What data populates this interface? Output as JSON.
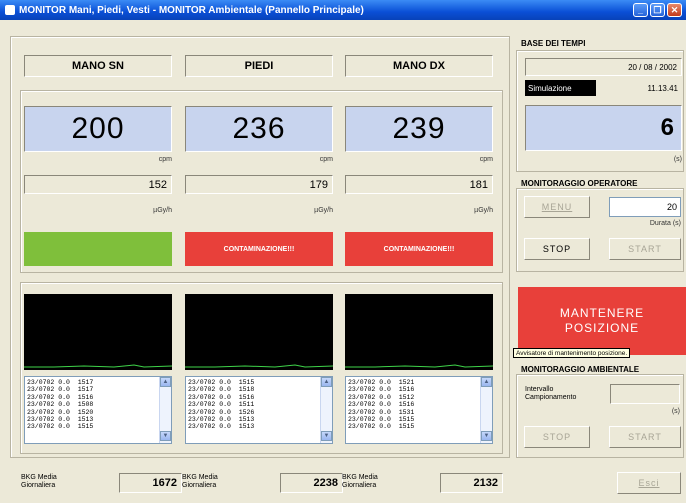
{
  "window": {
    "title": "MONITOR Mani, Piedi, Vesti - MONITOR Ambientale (Pannello Principale)"
  },
  "channels": [
    {
      "name": "MANO SN",
      "count": "200",
      "count_unit": "cpm",
      "dose": "152",
      "dose_unit": "µGy/h",
      "status": "",
      "status_color": "#7fbf3b",
      "log": [
        "23/0702 0.0  1517",
        "23/0702 0.0  1517",
        "23/0702 0.0  1516",
        "23/0702 0.0  1508",
        "23/0702 0.0  1520",
        "23/0702 0.0  1513",
        "23/0702 0.0  1515"
      ],
      "bkg_label": "BKG Media\nGiornaliera",
      "bkg_value": "1672"
    },
    {
      "name": "PIEDI",
      "count": "236",
      "count_unit": "cpm",
      "dose": "179",
      "dose_unit": "µGy/h",
      "status": "CONTAMINAZIONE!!!",
      "status_color": "#e8403a",
      "log": [
        "23/0702 0.0  1515",
        "23/0702 0.0  1518",
        "23/0702 0.0  1516",
        "23/0702 0.0  1511",
        "23/0702 0.0  1526",
        "23/0702 0.0  1513",
        "23/0702 0.0  1513"
      ],
      "bkg_label": "BKG Media\nGiornaliera",
      "bkg_value": "2238"
    },
    {
      "name": "MANO DX",
      "count": "239",
      "count_unit": "cpm",
      "dose": "181",
      "dose_unit": "µGy/h",
      "status": "CONTAMINAZIONE!!!",
      "status_color": "#e8403a",
      "log": [
        "23/0702 0.0  1521",
        "23/0702 0.0  1516",
        "23/0702 0.0  1512",
        "23/0702 0.0  1516",
        "23/0702 0.0  1531",
        "23/0702 0.0  1515",
        "23/0702 0.0  1515"
      ],
      "bkg_label": "BKG Media\nGiornaliera",
      "bkg_value": "2132"
    }
  ],
  "time_base": {
    "title": "BASE DEI TEMPI",
    "date": "20 / 08 / 2002",
    "mode": "Simulazione",
    "clock": "11.13.41",
    "seconds": "6",
    "seconds_unit": "(s)"
  },
  "operator": {
    "title": "MONITORAGGIO OPERATORE",
    "menu_label": "MENU",
    "duration_value": "20",
    "duration_label": "Durata (s)",
    "stop_label": "STOP",
    "start_label": "START"
  },
  "alert": {
    "text": "MANTENERE\nPOSIZIONE",
    "tooltip": "Avvisatore di mantenimento posizione."
  },
  "environment": {
    "title": "MONITORAGGIO AMBIENTALE",
    "interval_label": "Intervallo\nCampionamento",
    "interval_unit": "(s)",
    "stop_label": "STOP",
    "start_label": "START"
  },
  "exit_label": "Esci",
  "colors": {
    "titlebar": "#0a4fd6",
    "plot_trace": "#3fd44a",
    "alert": "#e8403a"
  }
}
